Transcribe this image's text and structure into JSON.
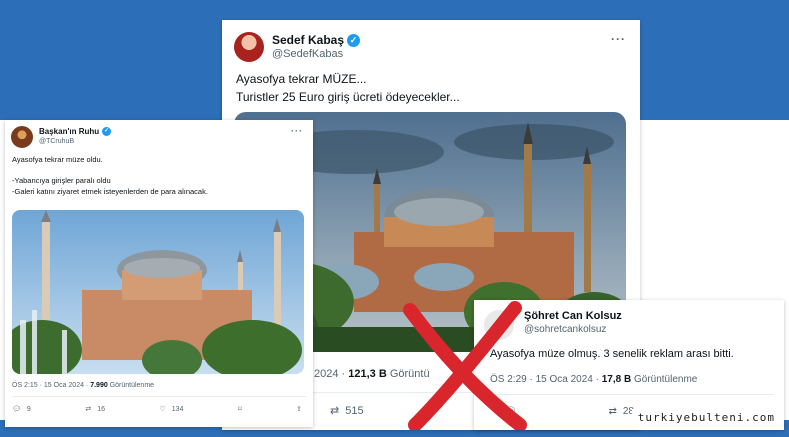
{
  "tweets": {
    "center": {
      "name": "Sedef Kabaş",
      "handle": "@SedefKabas",
      "text": "Ayasofya tekrar MÜZE...\nTuristler 25 Euro giriş ücreti ödeyecekler...",
      "meta_prefix": "2024 · ",
      "views": "121,3 B",
      "views_label": " Görüntü",
      "retweets": "515"
    },
    "left": {
      "name": "Başkan'ın Ruhu",
      "handle": "@TCruhuB",
      "text": "Ayasofya tekrar müze oldu.\n\n-Yabancıya girişler paralı oldu\n-Galeri katını ziyaret etmek isteyenlerden de para alınacak.",
      "time": "ÖS 2:15 · 15 Oca 2024 · ",
      "views": "7.990",
      "views_label": " Görüntülenme",
      "replies": "9",
      "retweets": "16",
      "likes": "134"
    },
    "right": {
      "name": "Şöhret Can Kolsuz",
      "handle": "@sohretcankolsuz",
      "text": "Ayasofya müze olmuş. 3 senelik reklam arası bitti.",
      "time": "ÖS 2:29 · 15 Oca 2024 · ",
      "views": "17,8 B",
      "views_label": " Görüntülenme",
      "retweets": "28"
    }
  },
  "watermark": "turkiyebulteni.com",
  "colors": {
    "brand_blue": "#2c6fb8",
    "verified": "#1d9bf0",
    "cross_red": "#d9262c"
  }
}
